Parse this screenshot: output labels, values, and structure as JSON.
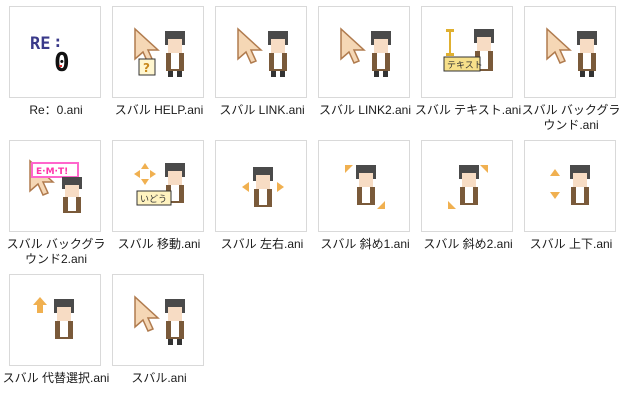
{
  "folder": {
    "files": [
      {
        "name": "Re：0.ani",
        "icon": "re-zero-logo-icon"
      },
      {
        "name": "スバル HELP.ani",
        "icon": "help-select-cursor-icon"
      },
      {
        "name": "スバル LINK.ani",
        "icon": "link-select-cursor-icon"
      },
      {
        "name": "スバル LINK2.ani",
        "icon": "link-select-cursor-icon"
      },
      {
        "name": "スバル テキスト.ani",
        "icon": "text-select-cursor-icon",
        "caption": "テキスト"
      },
      {
        "name": "スバル バックグラウンド.ani",
        "icon": "working-in-background-cursor-icon"
      },
      {
        "name": "スバル バックグラウンド2.ani",
        "icon": "working-in-background-cursor-icon",
        "caption": "E·M·T!"
      },
      {
        "name": "スバル 移動.ani",
        "icon": "move-cursor-icon",
        "caption": "いどう"
      },
      {
        "name": "スバル 左右.ani",
        "icon": "horizontal-resize-cursor-icon"
      },
      {
        "name": "スバル 斜め1.ani",
        "icon": "diagonal-resize-1-cursor-icon"
      },
      {
        "name": "スバル 斜め2.ani",
        "icon": "diagonal-resize-2-cursor-icon"
      },
      {
        "name": "スバル 上下.ani",
        "icon": "vertical-resize-cursor-icon"
      },
      {
        "name": "スバル 代替選択.ani",
        "icon": "alternate-select-cursor-icon"
      },
      {
        "name": "スバル.ani",
        "icon": "normal-select-cursor-icon"
      }
    ]
  },
  "colors": {
    "tile_border": "#d9d9d9",
    "cursor_fill": "#f5d7b5",
    "cursor_outline": "#b07b4e",
    "hair": "#4a4a4a",
    "skin": "#f7dcc4",
    "jacket": "#7a5a3a",
    "yellow_label": "#f7e08a",
    "pink_label": "#ff66cc"
  }
}
